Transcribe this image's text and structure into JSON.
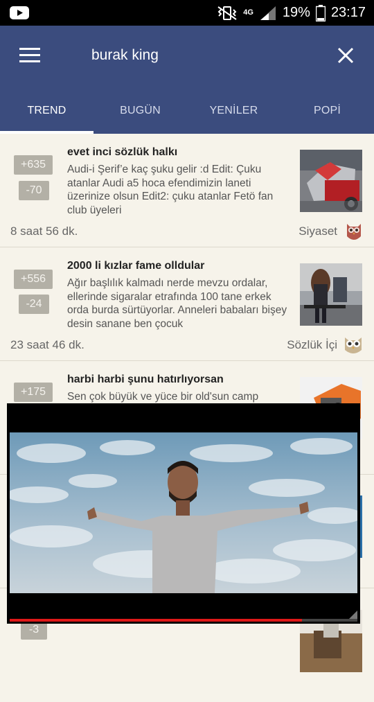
{
  "status": {
    "network": "4G",
    "battery": "19%",
    "time": "23:17"
  },
  "header": {
    "search_query": "burak king",
    "close_icon": "close-icon",
    "menu_icon": "hamburger-icon",
    "bg_color": "#3b4c7e"
  },
  "tabs": [
    {
      "label": "TREND",
      "active": true
    },
    {
      "label": "BUGÜN"
    },
    {
      "label": "YENİLER"
    },
    {
      "label": "POPİ"
    }
  ],
  "items": [
    {
      "up": "+635",
      "down": "-70",
      "title": "evet inci sözlük halkı",
      "body": "Audi-i Şerif’e kaç şuku gelir :d Edit: Çuku atanlar Audi a5 hoca efendimizin laneti üzerinize olsun Edit2: çuku atanlar Fetö fan club üyeleri",
      "time": "8 saat 56 dk.",
      "category": "Siyaset"
    },
    {
      "up": "+556",
      "down": "-24",
      "title": "2000 li kızlar fame olldular",
      "body": "Ağır başlılık kalmadı nerde mevzu ordalar, ellerinde sigaralar etrafında 100 tane erkek orda burda sürtüyorlar. Anneleri babaları bişey desin sanane ben çocuk",
      "time": "23 saat 46 dk.",
      "category": "Sözlük İçi"
    },
    {
      "up": "+175",
      "title": "harbi harbi şunu hatırlıyorsan",
      "body": "Sen çok büyük ve yüce bir old'sun camp"
    },
    {
      "down": "-3"
    }
  ],
  "video": {
    "progress": 0.84
  }
}
